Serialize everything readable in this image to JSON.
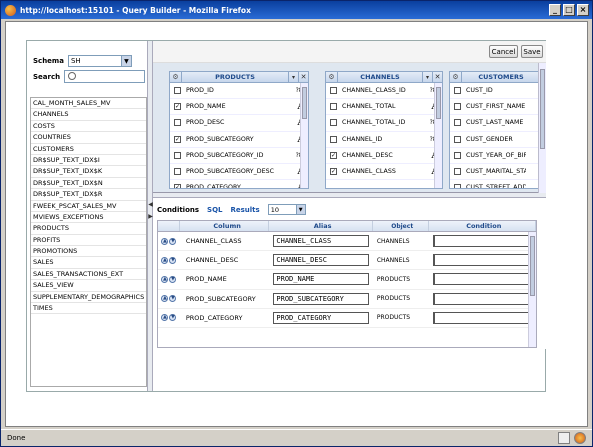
{
  "window": {
    "title": "http://localhost:15101 - Query Builder - Mozilla Firefox",
    "status": "Done"
  },
  "schema": {
    "label": "Schema",
    "value": "SH"
  },
  "search": {
    "label": "Search",
    "placeholder": ""
  },
  "tables": [
    "CAL_MONTH_SALES_MV",
    "CHANNELS",
    "COSTS",
    "COUNTRIES",
    "CUSTOMERS",
    "DR$SUP_TEXT_IDX$I",
    "DR$SUP_TEXT_IDX$K",
    "DR$SUP_TEXT_IDX$N",
    "DR$SUP_TEXT_IDX$R",
    "FWEEK_PSCAT_SALES_MV",
    "MVIEWS_EXCEPTIONS",
    "PRODUCTS",
    "PROFITS",
    "PROMOTIONS",
    "SALES",
    "SALES_TRANSACTIONS_EXT",
    "SALES_VIEW",
    "SUPPLEMENTARY_DEMOGRAPHICS",
    "TIMES"
  ],
  "toolbar": {
    "cancel_label": "Cancel",
    "save_label": "Save"
  },
  "cards": [
    {
      "title": "PRODUCTS",
      "columns": [
        {
          "name": "PROD_ID",
          "checked": false,
          "type": "?89"
        },
        {
          "name": "PROD_NAME",
          "checked": true,
          "type": "A"
        },
        {
          "name": "PROD_DESC",
          "checked": false,
          "type": "A"
        },
        {
          "name": "PROD_SUBCATEGORY",
          "checked": true,
          "type": "A"
        },
        {
          "name": "PROD_SUBCATEGORY_ID",
          "checked": false,
          "type": "?89"
        },
        {
          "name": "PROD_SUBCATEGORY_DESC",
          "checked": false,
          "type": "A"
        },
        {
          "name": "PROD_CATEGORY",
          "checked": true,
          "type": "A"
        }
      ]
    },
    {
      "title": "CHANNELS",
      "columns": [
        {
          "name": "CHANNEL_CLASS_ID",
          "checked": false,
          "type": "?89"
        },
        {
          "name": "CHANNEL_TOTAL",
          "checked": false,
          "type": "A"
        },
        {
          "name": "CHANNEL_TOTAL_ID",
          "checked": false,
          "type": "?89"
        },
        {
          "name": "CHANNEL_ID",
          "checked": false,
          "type": "?89"
        },
        {
          "name": "CHANNEL_DESC",
          "checked": true,
          "type": "A"
        },
        {
          "name": "CHANNEL_CLASS",
          "checked": true,
          "type": "A"
        }
      ]
    },
    {
      "title": "CUSTOMERS",
      "columns": [
        {
          "name": "CUST_ID",
          "checked": false,
          "type": ""
        },
        {
          "name": "CUST_FIRST_NAME",
          "checked": false,
          "type": ""
        },
        {
          "name": "CUST_LAST_NAME",
          "checked": false,
          "type": ""
        },
        {
          "name": "CUST_GENDER",
          "checked": false,
          "type": ""
        },
        {
          "name": "CUST_YEAR_OF_BIRT",
          "checked": false,
          "type": ""
        },
        {
          "name": "CUST_MARITAL_STAT",
          "checked": false,
          "type": ""
        },
        {
          "name": "CUST_STREET_ADDR",
          "checked": false,
          "type": ""
        }
      ]
    }
  ],
  "bottom_tabs": {
    "conditions": "Conditions",
    "sql": "SQL",
    "results": "Results",
    "limit": "10"
  },
  "grid": {
    "headers": {
      "column": "Column",
      "alias": "Alias",
      "object": "Object",
      "condition": "Condition"
    },
    "rows": [
      {
        "column": "CHANNEL_CLASS",
        "alias": "CHANNEL_CLASS",
        "object": "CHANNELS"
      },
      {
        "column": "CHANNEL_DESC",
        "alias": "CHANNEL_DESC",
        "object": "CHANNELS"
      },
      {
        "column": "PROD_NAME",
        "alias": "PROD_NAME",
        "object": "PRODUCTS"
      },
      {
        "column": "PROD_SUBCATEGORY",
        "alias": "PROD_SUBCATEGORY",
        "object": "PRODUCTS"
      },
      {
        "column": "PROD_CATEGORY",
        "alias": "PROD_CATEGORY",
        "object": "PRODUCTS"
      }
    ]
  }
}
